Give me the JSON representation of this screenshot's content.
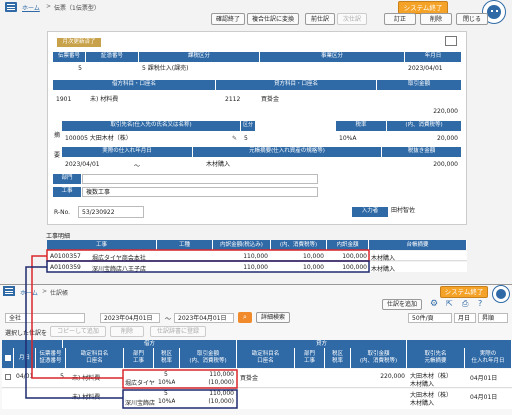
{
  "top": {
    "breadcrumb_home": "ホーム",
    "breadcrumb_sep": ">",
    "breadcrumb_page": "伝票（1伝票型）",
    "system_exit": "システム終了",
    "toolbar": {
      "confirm": "確認終了",
      "copy_to_multi": "複合仕訳に変換",
      "prev": "前仕訳",
      "next": "次仕訳",
      "correct": "訂正",
      "delete": "削除",
      "close": "閉じる"
    },
    "monthly_badge": "月次更新済了",
    "header_cols": [
      "伝票番号",
      "証憑番号",
      "課税区分",
      "事業区分",
      "年月日"
    ],
    "header_vals": {
      "voucher_no": "5",
      "tax_category": "5 課税仕入(課売)",
      "date": "2023/04/01"
    },
    "debit_title": "借方科目・口座名",
    "credit_title": "貸方科目・口座名",
    "amount_title": "取引金額",
    "debit_code": "1901",
    "debit_name": "未) 材料費",
    "credit_code": "2112",
    "credit_name": "買掛金",
    "amount": "220,000",
    "partner_title": "取引先名(仕入先の氏名又は名称)",
    "kbn_title": "区分",
    "tax_rate_title": "税率",
    "tax_amount_title": "(内、消費税等)",
    "partner": "100005 大田木材（株）",
    "kbn": "5",
    "tax_rate": "10%A",
    "tax_amount": "20,000",
    "side_label_top": "摘",
    "side_label_bottom": "要",
    "actual_date_title": "実際の仕入れ年月日",
    "memo_title": "元帳摘要(仕入れ資産の規格等)",
    "tax_excl_title": "税抜き金額",
    "actual_date": "2023/04/01",
    "tilde": "〜",
    "memo": "木材購入",
    "tax_excl": "200,000",
    "dept_label": "部門",
    "project_label": "工事",
    "project_value": "複数工事",
    "rno_label": "R-No.",
    "rno_value": "53/230922",
    "input_label": "入力者",
    "input_value": "田村智佐",
    "projects_title": "工事明細",
    "proj_cols": [
      "工事",
      "工種",
      "内訳金額(税込み)",
      "(内、消費税等)",
      "内訳金額",
      "台帳摘要"
    ],
    "proj_rows": [
      {
        "code": "A0100357",
        "name": "堀広タイヤ商会本社",
        "amount": "110,000",
        "tax": "10,000",
        "net": "100,000",
        "memo": "木材購入"
      },
      {
        "code": "A0100359",
        "name": "深川宝飾店八王子店",
        "amount": "110,000",
        "tax": "10,000",
        "net": "100,000",
        "memo": "木材購入"
      }
    ]
  },
  "bottom": {
    "breadcrumb_home": "ホーム",
    "breadcrumb_sep": ">",
    "breadcrumb_page": "仕訳帳",
    "system_exit": "システム終了",
    "add_journal": "仕訳を追加",
    "company": "全社",
    "date_from": "2023年04月01日",
    "date_to": "2023年04月01日",
    "tilde": "〜",
    "detail_search": "詳細検索",
    "per_page": "50件/頁",
    "unit": "月日",
    "order": "昇順",
    "selected_label": "選択した仕訳を",
    "copy_add": "コピーして追加",
    "delete": "削除",
    "register_template": "仕訳辞書に登録",
    "group_debit": "借方",
    "group_credit": "貸方",
    "cols": [
      "月日",
      "伝票番号\n証憑番号",
      "勘定科目名\n口座名",
      "部門\n工事",
      "税区\n税率",
      "取引金額\n(内、消費税等)",
      "勘定科目名\n口座名",
      "部門\n工事",
      "税区\n税率",
      "取引金額\n(内、消費税等)",
      "取引先名\n元帳摘要",
      "実際の\n仕入れ年月日"
    ],
    "row1": {
      "date": "04/01",
      "voucher": "5",
      "debit_name": "未) 材料費",
      "project": "堀広タイヤ",
      "kbn": "5",
      "rate": "10%A",
      "amount": "110,000",
      "tax": "(10,000)",
      "credit_name": "買掛金",
      "credit_amount": "220,000",
      "partner": "大田木材（株）",
      "memo": "木材購入",
      "actual": "04月01日"
    },
    "row2": {
      "debit_name": "未) 材料費",
      "project": "深川宝飾店",
      "kbn": "5",
      "rate": "10%A",
      "amount": "110,000",
      "tax": "(10,000)",
      "partner": "大田木材（株）",
      "memo": "木材購入",
      "actual": "04月01日"
    }
  },
  "colors": {
    "header_blue": "#2f6aa7",
    "system_orange": "#f4a228",
    "highlight_red": "#d9262b",
    "highlight_navy": "#1f2a6e"
  }
}
